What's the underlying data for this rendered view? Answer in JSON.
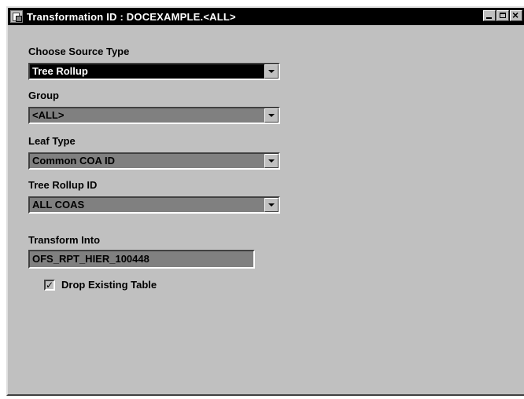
{
  "window": {
    "title": "Transformation ID : DOCEXAMPLE.<ALL>"
  },
  "form": {
    "source_type": {
      "label": "Choose Source Type",
      "value": "Tree Rollup"
    },
    "group": {
      "label": "Group",
      "value": "<ALL>"
    },
    "leaf_type": {
      "label": "Leaf Type",
      "value": "Common COA ID"
    },
    "tree_rollup": {
      "label": "Tree Rollup ID",
      "value": "ALL COAS"
    },
    "transform_into": {
      "label": "Transform Into",
      "value": "OFS_RPT_HIER_100448"
    },
    "drop_existing": {
      "label": "Drop Existing Table",
      "checked": true,
      "mark": "✓"
    }
  },
  "icons": {
    "window": "document-window-icon",
    "minimize": "minimize-icon",
    "maximize": "maximize-icon",
    "close": "close-icon",
    "dropdown": "chevron-down-icon",
    "checkbox": "checkmark-icon"
  }
}
